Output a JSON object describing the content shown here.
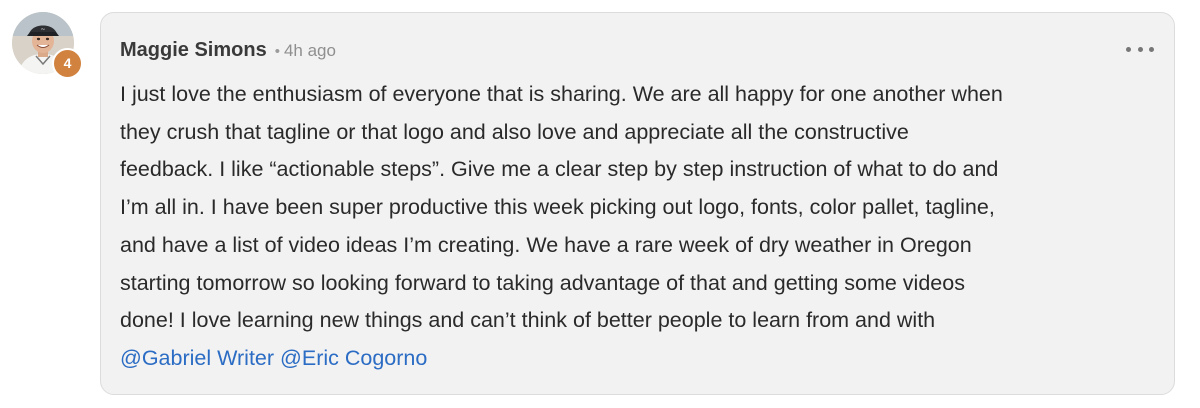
{
  "comment": {
    "author": "Maggie Simons",
    "separator": "•",
    "timestamp": "4h ago",
    "level_badge": "4",
    "more_icon": "more-horizontal-icon",
    "body_lines": [
      "I just love the enthusiasm of everyone that is sharing. We are all happy for one another when",
      "they crush that tagline or that logo and also love and appreciate all the constructive",
      "feedback. I like “actionable steps”. Give me a clear step by step instruction of what to do and",
      "I’m all in. I have been super productive this week picking out logo, fonts, color pallet, tagline,",
      "and have a list of video ideas I’m creating. We have a rare week of dry weather in Oregon",
      "starting tomorrow so looking forward to taking advantage of that and getting some videos",
      "done! I love learning new things and can’t think of better people to learn from and with"
    ],
    "mentions": [
      "@Gabriel Writer",
      "@Eric Cogorno"
    ]
  },
  "colors": {
    "bubble_background": "#f2f2f2",
    "badge": "#d1823e",
    "mention_link": "#2b6cc4",
    "author_text": "#3a3a3a",
    "meta_text": "#8f8f8f"
  }
}
